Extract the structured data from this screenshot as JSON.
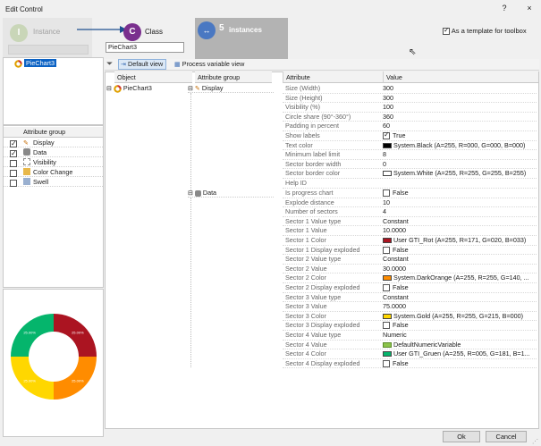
{
  "window": {
    "title": "Edit Control",
    "help": "?",
    "close": "×"
  },
  "steps": {
    "instance": {
      "num": "I",
      "label": "Instance"
    },
    "class": {
      "num": "C",
      "label": "Class",
      "input_value": "PieChart3"
    },
    "instances": {
      "num": "5",
      "label": "instances"
    }
  },
  "template_checkbox": {
    "label": "As a template for toolbox",
    "checked": true
  },
  "left_tree": {
    "item": "PieChart3"
  },
  "attr_groups": {
    "header": "Attribute group",
    "items": [
      {
        "label": "Display",
        "checked": true
      },
      {
        "label": "Data",
        "checked": true
      },
      {
        "label": "Visibility",
        "checked": false
      },
      {
        "label": "Color Change",
        "checked": false
      },
      {
        "label": "Swell",
        "checked": false
      }
    ]
  },
  "toolbar": {
    "default_view": "Default view",
    "process_view": "Process variable view"
  },
  "columns": {
    "object": "Object",
    "attribute_group": "Attribute group",
    "attribute": "Attribute",
    "value": "Value"
  },
  "object_tree": {
    "item": "PieChart3"
  },
  "groups": {
    "display": "Display",
    "data": "Data"
  },
  "display_rows": [
    {
      "name": "Size (Width)",
      "value": "300"
    },
    {
      "name": "Size (Height)",
      "value": "300"
    },
    {
      "name": "Visibility (%)",
      "value": "100"
    },
    {
      "name": "Circle share (90°-360°)",
      "value": "360"
    },
    {
      "name": "Padding in percent",
      "value": "60"
    },
    {
      "name": "Show labels",
      "value": "True",
      "checkbox": true,
      "checked": true
    },
    {
      "name": "Text color",
      "value": "System.Black (A=255, R=000, G=000, B=000)",
      "swatch": "#000000"
    },
    {
      "name": "Minimum label limit",
      "value": "8"
    },
    {
      "name": "Sector border width",
      "value": "0"
    },
    {
      "name": "Sector border color",
      "value": "System.White (A=255, R=255, G=255, B=255)",
      "swatch": "#ffffff"
    },
    {
      "name": "Help ID",
      "value": ""
    }
  ],
  "data_rows": [
    {
      "name": "Is progress chart",
      "value": "False",
      "checkbox": true,
      "checked": false
    },
    {
      "name": "Explode distance",
      "value": "10"
    },
    {
      "name": "Number of sectors",
      "value": "4"
    },
    {
      "name": "Sector 1 Value type",
      "value": "Constant"
    },
    {
      "name": "Sector 1 Value",
      "value": "10.0000"
    },
    {
      "name": "Sector 1 Color",
      "value": "User GTI_Rot (A=255, R=171, G=020, B=033)",
      "swatch": "#ab1421"
    },
    {
      "name": "Sector 1 Display exploded",
      "value": "False",
      "checkbox": true,
      "checked": false
    },
    {
      "name": "Sector 2 Value type",
      "value": "Constant"
    },
    {
      "name": "Sector 2 Value",
      "value": "30.0000"
    },
    {
      "name": "Sector 2 Color",
      "value": "System.DarkOrange (A=255, R=255, G=140, ...",
      "swatch": "#ff8c00"
    },
    {
      "name": "Sector 2 Display exploded",
      "value": "False",
      "checkbox": true,
      "checked": false
    },
    {
      "name": "Sector 3 Value type",
      "value": "Constant"
    },
    {
      "name": "Sector 3 Value",
      "value": "75.0000"
    },
    {
      "name": "Sector 3 Color",
      "value": "System.Gold (A=255, R=255, G=215, B=000)",
      "swatch": "#ffd700"
    },
    {
      "name": "Sector 3 Display exploded",
      "value": "False",
      "checkbox": true,
      "checked": false
    },
    {
      "name": "Sector 4 Value type",
      "value": "Numeric"
    },
    {
      "name": "Sector 4 Value",
      "value": "DefaultNumericVariable",
      "icon": true
    },
    {
      "name": "Sector 4 Color",
      "value": "User GTI_Gruen (A=255, R=005, G=181, B=1...",
      "swatch": "#05b56c"
    },
    {
      "name": "Sector 4 Display exploded",
      "value": "False",
      "checkbox": true,
      "checked": false
    }
  ],
  "preview": {
    "segments": [
      {
        "color": "#ab1421",
        "label": "25.00%",
        "share": 0.25
      },
      {
        "color": "#ff8c00",
        "label": "25.00%",
        "share": 0.25
      },
      {
        "color": "#ffd700",
        "label": "25.00%",
        "share": 0.25
      },
      {
        "color": "#05b56c",
        "label": "25.00%",
        "share": 0.25
      }
    ]
  },
  "buttons": {
    "ok": "Ok",
    "cancel": "Cancel"
  }
}
